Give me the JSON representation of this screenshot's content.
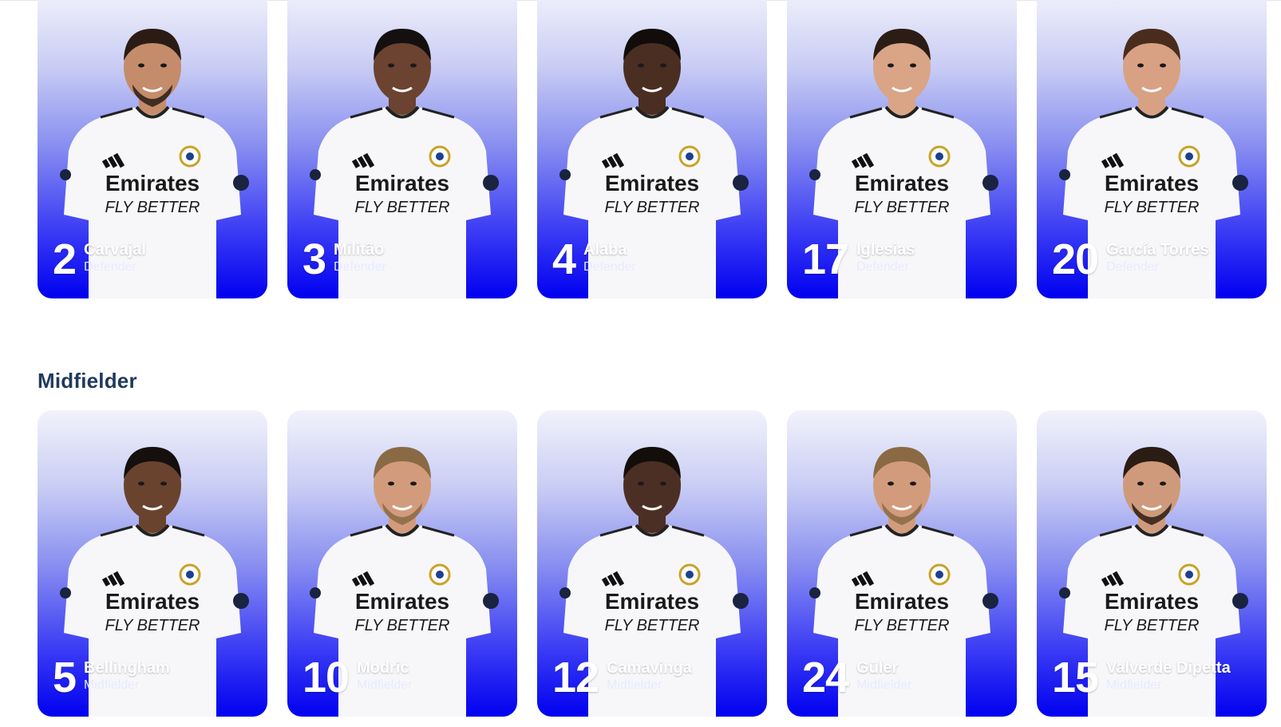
{
  "colors": {
    "card_top": "#f2f2fb",
    "card_bottom": "#0000f0",
    "heading": "#1f3a5c",
    "caption_text": "#ffffff"
  },
  "sections": [
    {
      "heading": "",
      "players": [
        {
          "number": "2",
          "name": "Carvajal",
          "position": "Defender",
          "skin": "#c48c6a",
          "hair": "#2a1c14",
          "beard": true
        },
        {
          "number": "3",
          "name": "Militão",
          "position": "Defender",
          "skin": "#6b4330",
          "hair": "#151010",
          "beard": false
        },
        {
          "number": "4",
          "name": "Alaba",
          "position": "Defender",
          "skin": "#4a2e22",
          "hair": "#120c0a",
          "beard": false
        },
        {
          "number": "17",
          "name": "Iglesias",
          "position": "Defender",
          "skin": "#d9a586",
          "hair": "#2b1d16",
          "beard": false
        },
        {
          "number": "20",
          "name": "García Torres",
          "position": "Defender",
          "skin": "#d8a184",
          "hair": "#4a2c1c",
          "beard": false
        }
      ]
    },
    {
      "heading": "Midfielder",
      "players": [
        {
          "number": "5",
          "name": "Bellingham",
          "position": "Midfielder",
          "skin": "#6a432f",
          "hair": "#15100d",
          "beard": false
        },
        {
          "number": "10",
          "name": "Modric",
          "position": "Midfielder",
          "skin": "#d29c7c",
          "hair": "#8a6a45",
          "beard": true
        },
        {
          "number": "12",
          "name": "Camavinga",
          "position": "Midfielder",
          "skin": "#4c2f24",
          "hair": "#140e0b",
          "beard": false
        },
        {
          "number": "24",
          "name": "Güler",
          "position": "Midfielder",
          "skin": "#d29c7c",
          "hair": "#8a6a45",
          "beard": true
        },
        {
          "number": "15",
          "name": "Valverde Dipetta",
          "position": "Midfielder",
          "skin": "#cf9a7b",
          "hair": "#2b1c14",
          "beard": true
        }
      ]
    }
  ],
  "jersey": {
    "sponsor_line1": "Emirates",
    "sponsor_line2": "FLY BETTER"
  }
}
